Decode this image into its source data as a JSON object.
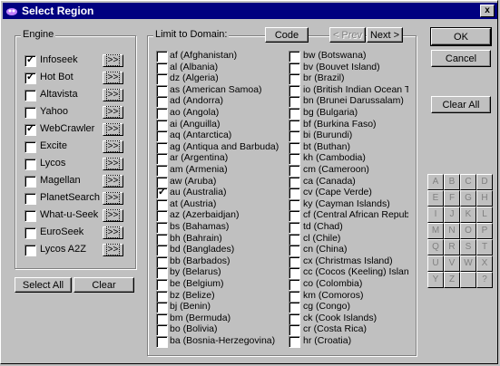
{
  "window": {
    "title": "Select Region",
    "close_label": "x"
  },
  "engine": {
    "group_label": "Engine",
    "arrow_label": ">>",
    "items": [
      {
        "label": "Infoseek",
        "checked": true
      },
      {
        "label": "Hot Bot",
        "checked": true
      },
      {
        "label": "Altavista",
        "checked": false
      },
      {
        "label": "Yahoo",
        "checked": false
      },
      {
        "label": "WebCrawler",
        "checked": true
      },
      {
        "label": "Excite",
        "checked": false
      },
      {
        "label": "Lycos",
        "checked": false
      },
      {
        "label": "Magellan",
        "checked": false
      },
      {
        "label": "PlanetSearch",
        "checked": false
      },
      {
        "label": "What-u-Seek",
        "checked": false
      },
      {
        "label": "EuroSeek",
        "checked": false
      },
      {
        "label": "Lycos A2Z",
        "checked": false
      }
    ],
    "select_all_label": "Select All",
    "clear_label": "Clear"
  },
  "domain": {
    "group_label": "Limit to Domain:",
    "code_label": "Code",
    "prev_label": "< Prev",
    "next_label": "Next >",
    "col1": [
      {
        "label": "af (Afghanistan)",
        "checked": false
      },
      {
        "label": "al (Albania)",
        "checked": false
      },
      {
        "label": "dz (Algeria)",
        "checked": false
      },
      {
        "label": "as (American Samoa)",
        "checked": false
      },
      {
        "label": "ad (Andorra)",
        "checked": false
      },
      {
        "label": "ao (Angola)",
        "checked": false
      },
      {
        "label": "ai (Anguilla)",
        "checked": false
      },
      {
        "label": "aq (Antarctica)",
        "checked": false
      },
      {
        "label": "ag (Antiqua and Barbuda)",
        "checked": false
      },
      {
        "label": "ar (Argentina)",
        "checked": false
      },
      {
        "label": "am (Armenia)",
        "checked": false
      },
      {
        "label": "aw (Aruba)",
        "checked": false
      },
      {
        "label": "au (Australia)",
        "checked": true
      },
      {
        "label": "at (Austria)",
        "checked": false
      },
      {
        "label": "az (Azerbaidjan)",
        "checked": false
      },
      {
        "label": "bs (Bahamas)",
        "checked": false
      },
      {
        "label": "bh (Bahrain)",
        "checked": false
      },
      {
        "label": "bd (Banglades)",
        "checked": false
      },
      {
        "label": "bb (Barbados)",
        "checked": false
      },
      {
        "label": "by (Belarus)",
        "checked": false
      },
      {
        "label": "be (Belgium)",
        "checked": false
      },
      {
        "label": "bz (Belize)",
        "checked": false
      },
      {
        "label": "bj (Benin)",
        "checked": false
      },
      {
        "label": "bm (Bermuda)",
        "checked": false
      },
      {
        "label": "bo (Bolivia)",
        "checked": false
      },
      {
        "label": "ba (Bosnia-Herzegovina)",
        "checked": false
      }
    ],
    "col2": [
      {
        "label": "bw (Botswana)",
        "checked": false
      },
      {
        "label": "bv (Bouvet Island)",
        "checked": false
      },
      {
        "label": "br (Brazil)",
        "checked": false
      },
      {
        "label": "io (British Indian Ocean T",
        "checked": false
      },
      {
        "label": "bn (Brunei Darussalam)",
        "checked": false
      },
      {
        "label": "bg (Bulgaria)",
        "checked": false
      },
      {
        "label": "bf (Burkina Faso)",
        "checked": false
      },
      {
        "label": "bi (Burundi)",
        "checked": false
      },
      {
        "label": "bt (Buthan)",
        "checked": false
      },
      {
        "label": "kh (Cambodia)",
        "checked": false
      },
      {
        "label": "cm (Cameroon)",
        "checked": false
      },
      {
        "label": "ca (Canada)",
        "checked": false
      },
      {
        "label": "cv (Cape Verde)",
        "checked": false
      },
      {
        "label": "ky (Cayman Islands)",
        "checked": false
      },
      {
        "label": "cf (Central African Repub",
        "checked": false
      },
      {
        "label": "td (Chad)",
        "checked": false
      },
      {
        "label": "cl (Chile)",
        "checked": false
      },
      {
        "label": "cn (China)",
        "checked": false
      },
      {
        "label": "cx (Christmas Island)",
        "checked": false
      },
      {
        "label": "cc (Cocos (Keeling) Island",
        "checked": false
      },
      {
        "label": "co (Colombia)",
        "checked": false
      },
      {
        "label": "km (Comoros)",
        "checked": false
      },
      {
        "label": "cg (Congo)",
        "checked": false
      },
      {
        "label": "ck (Cook Islands)",
        "checked": false
      },
      {
        "label": "cr (Costa Rica)",
        "checked": false
      },
      {
        "label": "hr (Croatia)",
        "checked": false
      }
    ]
  },
  "actions": {
    "ok_label": "OK",
    "cancel_label": "Cancel",
    "clear_all_label": "Clear All"
  },
  "letters": [
    "A",
    "B",
    "C",
    "D",
    "E",
    "F",
    "G",
    "H",
    "I",
    "J",
    "K",
    "L",
    "M",
    "N",
    "O",
    "P",
    "Q",
    "R",
    "S",
    "T",
    "U",
    "V",
    "W",
    "X",
    "Y",
    "Z",
    "",
    "?"
  ]
}
